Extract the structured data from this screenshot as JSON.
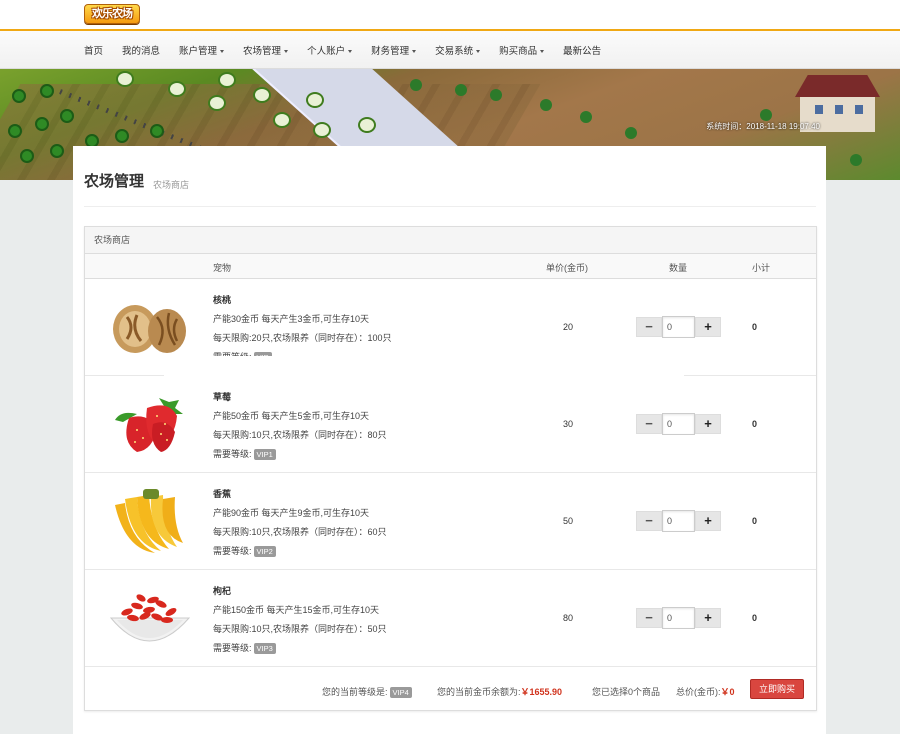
{
  "logo": {
    "text": "欢乐农场"
  },
  "nav": {
    "items": [
      {
        "label": "首页",
        "dropdown": false
      },
      {
        "label": "我的消息",
        "dropdown": false
      },
      {
        "label": "账户管理",
        "dropdown": true
      },
      {
        "label": "农场管理",
        "dropdown": true
      },
      {
        "label": "个人账户",
        "dropdown": true
      },
      {
        "label": "财务管理",
        "dropdown": true
      },
      {
        "label": "交易系统",
        "dropdown": true
      },
      {
        "label": "购买商品",
        "dropdown": true
      },
      {
        "label": "最新公告",
        "dropdown": false
      }
    ]
  },
  "banner": {
    "system_time": "系统时间：2018-11-18 19:07:40"
  },
  "page": {
    "title": "农场管理",
    "subtitle": "农场商店"
  },
  "store": {
    "box_title": "农场商店",
    "headers": {
      "pet": "宠物",
      "price": "单价(金币)",
      "qty": "数量",
      "subtotal": "小计"
    },
    "items": [
      {
        "name": "核桃",
        "line1": "产能30金币 每天产生3金币,可生存10天",
        "line2": "每天限购:20只,农场限养（同时存在）：100只",
        "level_label": "需要等级:",
        "vip": "VIP",
        "price": "20",
        "qty": "0",
        "subtotal": "0",
        "icon": "walnut-image"
      },
      {
        "name": "草莓",
        "line1": "产能50金币 每天产生5金币,可生存10天",
        "line2": "每天限购:10只,农场限养（同时存在）：80只",
        "level_label": "需要等级:",
        "vip": "VIP1",
        "price": "30",
        "qty": "0",
        "subtotal": "0",
        "icon": "strawberry-image"
      },
      {
        "name": "香蕉",
        "line1": "产能90金币 每天产生9金币,可生存10天",
        "line2": "每天限购:10只,农场限养（同时存在）：60只",
        "level_label": "需要等级:",
        "vip": "VIP2",
        "price": "50",
        "qty": "0",
        "subtotal": "0",
        "icon": "banana-image"
      },
      {
        "name": "枸杞",
        "line1": "产能150金币 每天产生15金币,可生存10天",
        "line2": "每天限购:10只,农场限养（同时存在）：50只",
        "level_label": "需要等级:",
        "vip": "VIP3",
        "price": "80",
        "qty": "0",
        "subtotal": "0",
        "icon": "goji-image"
      }
    ],
    "footer": {
      "level_label": "您的当前等级是:",
      "level_value": "VIP4",
      "balance_label": "您的当前金币余额为:",
      "balance_value": "￥1655.90",
      "selected_text": "您已选择0个商品",
      "total_label": "总价(金币):",
      "total_value": "￥0",
      "buy_button": "立即购买"
    }
  },
  "colors": {
    "accent": "#f0a814",
    "buy": "#d9463f",
    "price_red": "#d0321c"
  }
}
